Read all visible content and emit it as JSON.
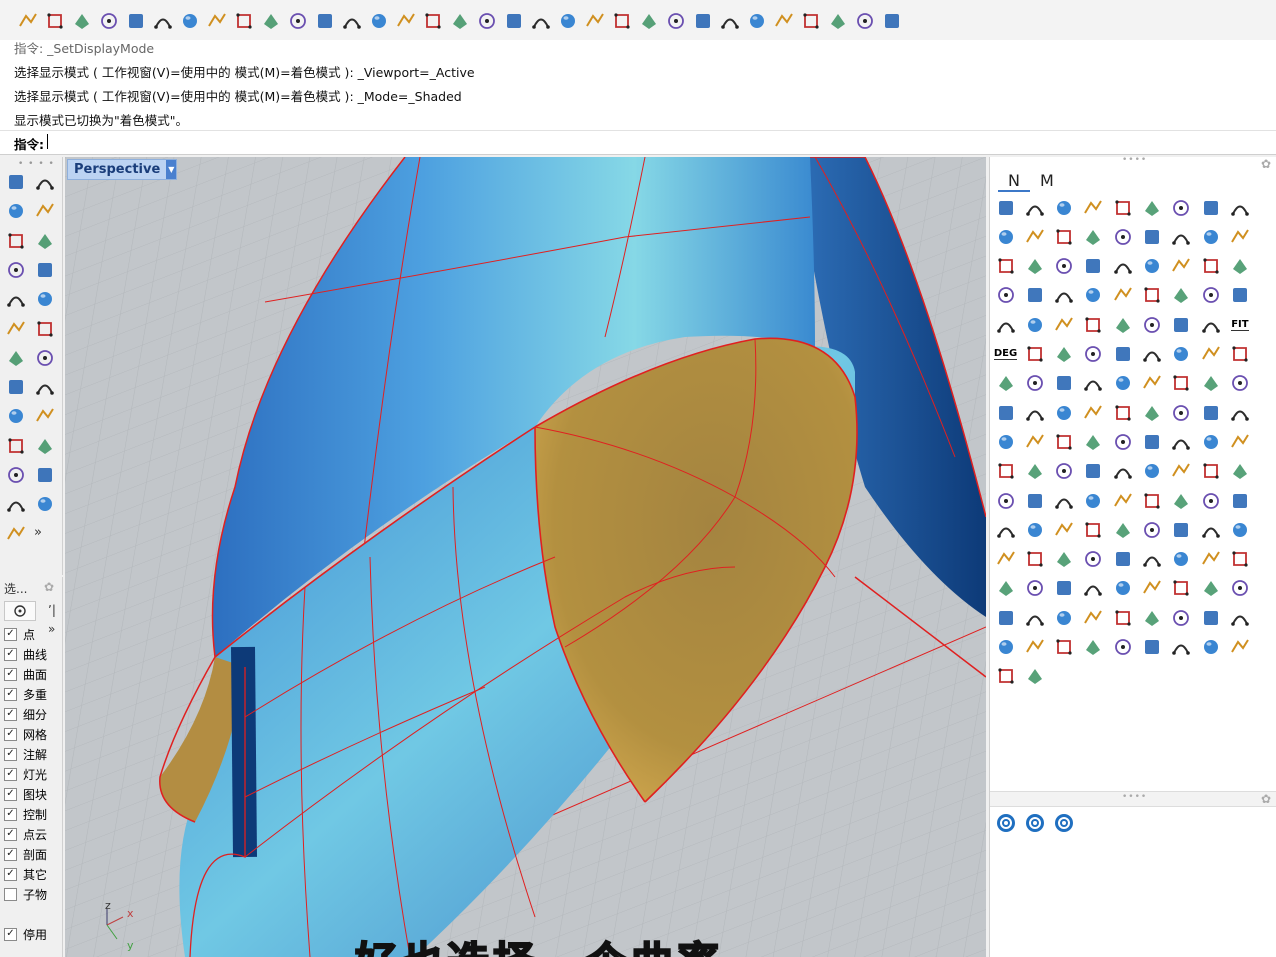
{
  "toolbar": {
    "icons": [
      "new-file-icon",
      "open-folder-icon",
      "save-icon",
      "print-icon",
      "import-icon",
      "cut-icon",
      "copy-icon",
      "paste-icon",
      "undo-icon",
      "pan-hand-icon",
      "rotate-view-icon",
      "zoom-icon",
      "zoom-window-icon",
      "zoom-extents-icon",
      "zoom-selected-icon",
      "rotate-icon",
      "four-views-icon",
      "car-icon",
      "plane-icon",
      "target-icon",
      "snap-icon",
      "light-icon",
      "lock-icon",
      "layer-icon",
      "color-wheel-icon",
      "sphere-wire-icon",
      "sphere-grid-icon",
      "render-sphere-icon",
      "flag-icon",
      "gear-icon",
      "dimension-icon",
      "globe-icon",
      "help-icon"
    ]
  },
  "command": {
    "lines": [
      "指令: _SetDisplayMode",
      "选择显示模式 ( 工作视窗(V)=使用中的  模式(M)=着色模式 ): _Viewport=_Active",
      "选择显示模式 ( 工作视窗(V)=使用中的  模式(M)=着色模式 ): _Mode=_Shaded",
      "显示模式已切换为\"着色模式\"。"
    ],
    "prompt_label": "指令:"
  },
  "viewport": {
    "name": "Perspective",
    "dropdown_glyph": "▼",
    "axes": {
      "x": "x",
      "y": "y",
      "z": "z"
    },
    "subtitle": "好也选择一个曲率"
  },
  "left_toolbar": {
    "more_glyph": "»"
  },
  "layers_panel": {
    "title": "选...",
    "more_glyph": "»",
    "items": [
      {
        "label": "点",
        "checked": true
      },
      {
        "label": "曲线",
        "checked": true
      },
      {
        "label": "曲面",
        "checked": true
      },
      {
        "label": "多重",
        "checked": true
      },
      {
        "label": "细分",
        "checked": true
      },
      {
        "label": "网格",
        "checked": true
      },
      {
        "label": "注解",
        "checked": true
      },
      {
        "label": "灯光",
        "checked": true
      },
      {
        "label": "图块",
        "checked": true
      },
      {
        "label": "控制",
        "checked": true
      },
      {
        "label": "点云",
        "checked": true
      },
      {
        "label": "剖面",
        "checked": true
      },
      {
        "label": "其它",
        "checked": true
      },
      {
        "label": "子物",
        "checked": false
      },
      {
        "label": "停用",
        "checked": true
      }
    ]
  },
  "right_panel": {
    "tabs": [
      "N",
      "M"
    ],
    "fit_label": "FIT",
    "deg_label": "DEG"
  },
  "colors": {
    "surface_blue": "#3f8fd8",
    "surface_cyan": "#7fd0e0",
    "surface_gold": "#b89040",
    "edge_red": "#e02020",
    "viewport_bg": "#c0c4c8"
  }
}
